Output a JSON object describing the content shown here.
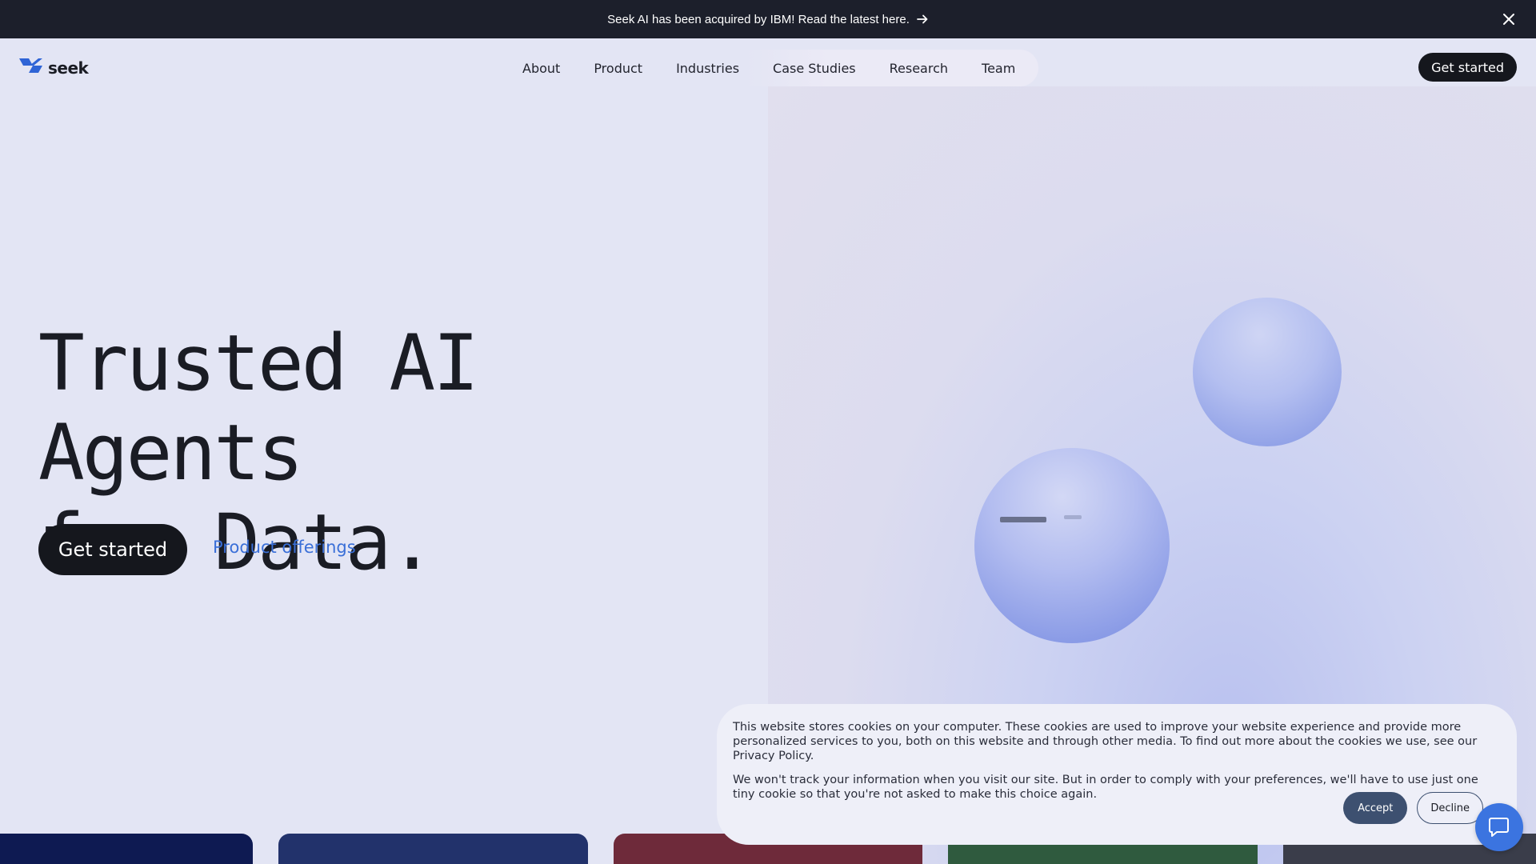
{
  "announcement": {
    "text": "Seek AI has been acquired by IBM! Read the latest here.",
    "arrow_icon": "arrow-right-icon",
    "close_icon": "close-icon"
  },
  "logo": {
    "text": "seek",
    "icon": "seek-logo-icon"
  },
  "nav": {
    "items": [
      {
        "label": "About"
      },
      {
        "label": "Product"
      },
      {
        "label": "Industries"
      },
      {
        "label": "Case Studies"
      },
      {
        "label": "Research"
      },
      {
        "label": "Team"
      }
    ],
    "cta_label": "Get started"
  },
  "hero": {
    "headline_line1": "Trusted AI Agents",
    "headline_line2": "for Data.",
    "cta_label": "Get started",
    "link_label": "Product offerings"
  },
  "cards": {
    "colors": [
      "#0e1a52",
      "#22326b",
      "#6e2a3a",
      "#2f5a3e",
      "#3a3d4a"
    ]
  },
  "cookie_banner": {
    "paragraph1": "This website stores cookies on your computer. These cookies are used to improve your website experience and provide more personalized services to you, both on this website and through other media. To find out more about the cookies we use, see our Privacy Policy.",
    "paragraph2": "We won't track your information when you visit our site. But in order to comply with your preferences, we'll have to use just one tiny cookie so that you're not asked to make this choice again.",
    "accept_label": "Accept",
    "decline_label": "Decline"
  },
  "chat_widget": {
    "icon": "chat-icon"
  },
  "colors": {
    "announcement_bg": "#1c1f2b",
    "page_bg": "#e3e5f4",
    "primary_dark": "#15171d",
    "link_blue": "#3a6fd8",
    "chat_blue": "#3b74e0"
  }
}
